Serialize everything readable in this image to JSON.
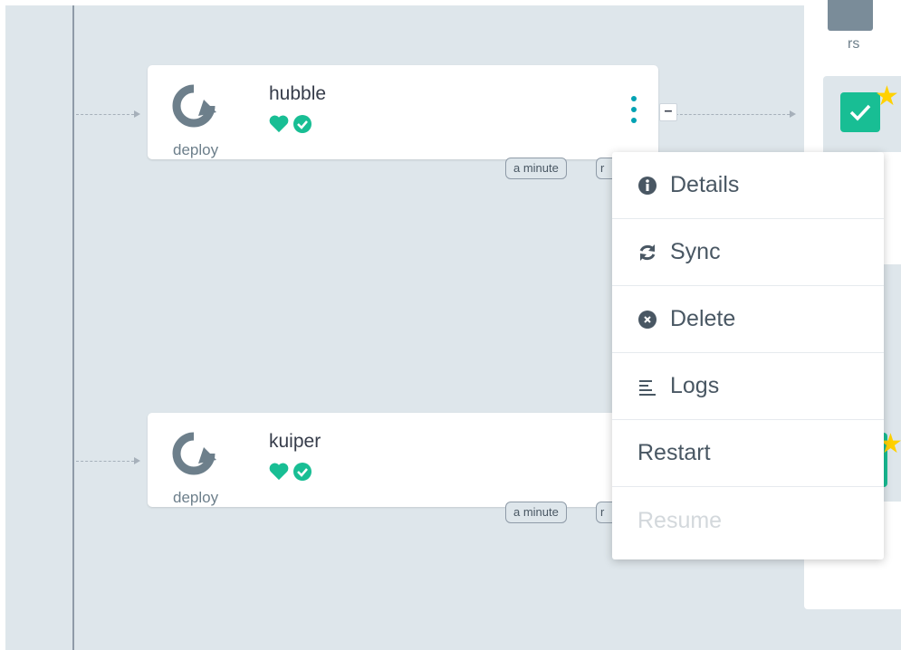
{
  "app_nodes": [
    {
      "name": "hubble",
      "kind": "deploy",
      "tags": [
        "a minute",
        "r"
      ]
    },
    {
      "name": "kuiper",
      "kind": "deploy",
      "tags": [
        "a minute",
        "r"
      ]
    }
  ],
  "right_panel": {
    "rs_label": "rs"
  },
  "context_menu": {
    "items": [
      {
        "label": "Details",
        "icon": "info-circle-icon",
        "disabled": false
      },
      {
        "label": "Sync",
        "icon": "sync-icon",
        "disabled": false
      },
      {
        "label": "Delete",
        "icon": "times-circle-icon",
        "disabled": false
      },
      {
        "label": "Logs",
        "icon": "align-left-icon",
        "disabled": false
      },
      {
        "label": "Restart",
        "icon": "",
        "disabled": false
      },
      {
        "label": "Resume",
        "icon": "",
        "disabled": true
      }
    ]
  },
  "colors": {
    "healthy": "#18be94",
    "synced": "#18be94",
    "accent": "#00a2b3",
    "star": "#ffd100"
  }
}
